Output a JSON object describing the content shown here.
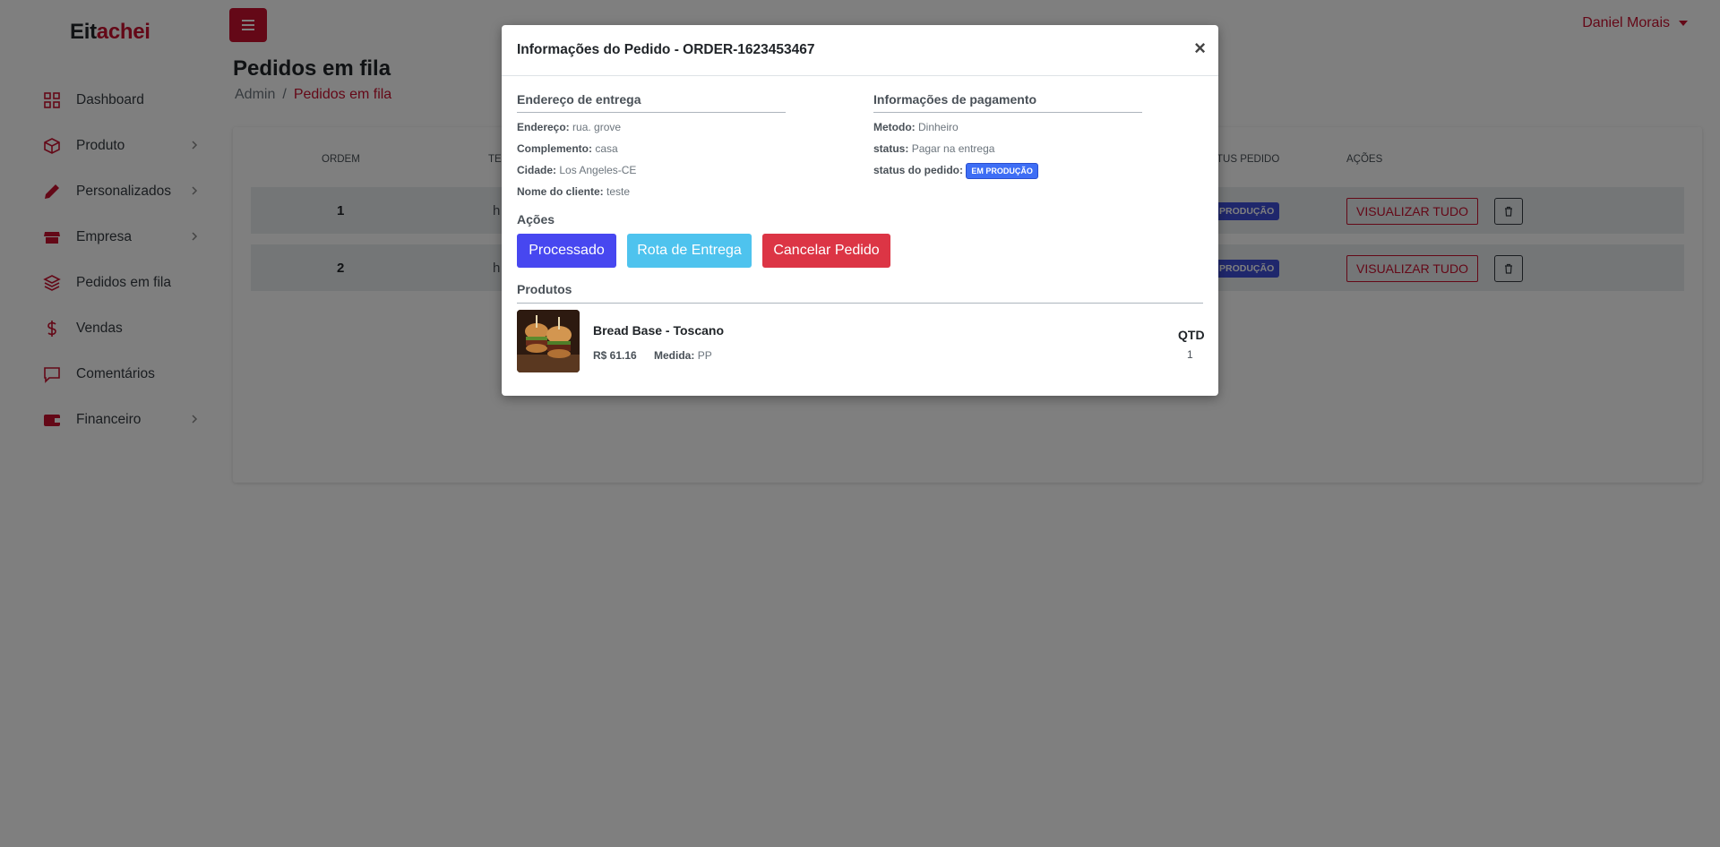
{
  "brand": {
    "part1": "Eit",
    "part2": "achei"
  },
  "user": {
    "name": "Daniel Morais"
  },
  "sidebar": {
    "items": [
      {
        "label": "Dashboard",
        "icon": "grid-icon",
        "has_submenu": false
      },
      {
        "label": "Produto",
        "icon": "box-icon",
        "has_submenu": true
      },
      {
        "label": "Personalizados",
        "icon": "pencil-icon",
        "has_submenu": true
      },
      {
        "label": "Empresa",
        "icon": "store-icon",
        "has_submenu": true
      },
      {
        "label": "Pedidos em fila",
        "icon": "layers-icon",
        "has_submenu": false
      },
      {
        "label": "Vendas",
        "icon": "dollar-icon",
        "has_submenu": false
      },
      {
        "label": "Comentários",
        "icon": "chat-icon",
        "has_submenu": false
      },
      {
        "label": "Financeiro",
        "icon": "wallet-icon",
        "has_submenu": true
      }
    ]
  },
  "page": {
    "title": "Pedidos em fila",
    "breadcrumb": {
      "root": "Admin",
      "separator": "/",
      "current": "Pedidos em fila"
    }
  },
  "table": {
    "headers": {
      "ordem": "ORDEM",
      "te": "TE",
      "status": "TUS PEDIDO",
      "acoes": "AÇÕES"
    },
    "rows": [
      {
        "ordem": "1",
        "frag": "h",
        "status": "PRODUÇÃO",
        "view_label": "VISUALIZAR TUDO"
      },
      {
        "ordem": "2",
        "frag": "h",
        "status": "PRODUÇÃO",
        "view_label": "VISUALIZAR TUDO"
      }
    ]
  },
  "modal": {
    "title": "Informações do Pedido - ORDER-1623453467",
    "close": "×",
    "delivery": {
      "title": "Endereço de entrega",
      "endereco_label": "Endereço:",
      "endereco": "rua. grove",
      "complemento_label": "Complemento:",
      "complemento": "casa",
      "cidade_label": "Cidade:",
      "cidade": "Los Angeles-CE",
      "cliente_label": "Nome do cliente:",
      "cliente": "teste"
    },
    "payment": {
      "title": "Informações de pagamento",
      "metodo_label": "Metodo:",
      "metodo": "Dinheiro",
      "status_label": "status:",
      "status": "Pagar na entrega",
      "pedido_label": "status do pedido:",
      "pedido_badge": "EM PRODUÇÃO"
    },
    "actions": {
      "title": "Ações",
      "processado": "Processado",
      "rota": "Rota de Entrega",
      "cancelar": "Cancelar Pedido"
    },
    "products": {
      "title": "Produtos",
      "items": [
        {
          "name": "Bread Base - Toscano",
          "price": "R$ 61.16",
          "medida_label": "Medida:",
          "medida": "PP",
          "qtd_label": "QTD",
          "qtd": "1"
        }
      ]
    }
  },
  "colors": {
    "brand": "#c8102e",
    "primary": "#4747f0",
    "info": "#4ec3ee",
    "danger": "#dc3545",
    "badge": "#3e6ef5"
  }
}
